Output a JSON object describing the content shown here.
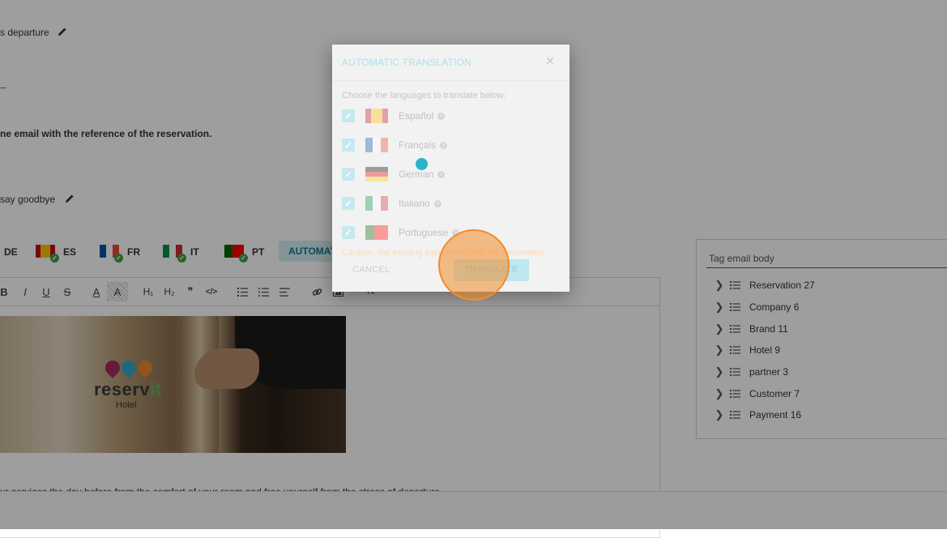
{
  "page": {
    "section_departure": "s departure",
    "email_reference_text": "ne email with the reference of the reservation.",
    "section_goodbye": "say goodbye",
    "body_text": "ur services the day before from the comfort of your room and free yourself from the stress of departure"
  },
  "lang_tabs": [
    {
      "code": "DE"
    },
    {
      "code": "ES",
      "colors": [
        "#c60b1e",
        "#ffc400",
        "#c60b1e"
      ]
    },
    {
      "code": "FR",
      "colors": [
        "#0055a4",
        "#ffffff",
        "#ef4135"
      ]
    },
    {
      "code": "IT",
      "colors": [
        "#009246",
        "#ffffff",
        "#ce2b37"
      ]
    },
    {
      "code": "PT",
      "colors": [
        "#006600",
        "#ff0000",
        "#ff0000"
      ]
    }
  ],
  "auto_translate_button": "AUTOMATI",
  "toolbar": {
    "icons": [
      "bold-icon",
      "italic-icon",
      "underline-icon",
      "strikethrough-icon",
      "font-color-icon",
      "highlight-icon",
      "heading1-icon",
      "heading2-icon",
      "quote-icon",
      "code-icon",
      "ordered-list-icon",
      "bullet-list-icon",
      "align-icon",
      "link-icon",
      "image-icon",
      "clear-format-icon"
    ],
    "glyphs": {
      "bold": "B",
      "italic": "I",
      "underline": "U",
      "strike": "S",
      "fontcolor": "A",
      "highlight": "A",
      "h1": "H₁",
      "h2": "H₂",
      "quote": "❞",
      "code": "</>",
      "link": "🔗",
      "clear": "Tx"
    }
  },
  "image": {
    "logo_text_main": "reserv",
    "logo_text_accent": "it",
    "logo_sub": "Hotel"
  },
  "tag_panel": {
    "input_value": "Tag email body",
    "items": [
      {
        "label": "Reservation 27"
      },
      {
        "label": "Company 6"
      },
      {
        "label": "Brand 11"
      },
      {
        "label": "Hotel 9"
      },
      {
        "label": "partner 3"
      },
      {
        "label": "Customer 7"
      },
      {
        "label": "Payment 16"
      }
    ]
  },
  "dialog": {
    "title": "AUTOMATIC TRANSLATION",
    "close_glyph": "✕",
    "intro": "Choose the languages to translate below:",
    "languages": [
      {
        "name": "Español",
        "checked": true,
        "colors": [
          "#c60b1e",
          "#ffc400",
          "#c60b1e"
        ]
      },
      {
        "name": "Français",
        "checked": true,
        "colors": [
          "#0055a4",
          "#ffffff",
          "#ef4135"
        ]
      },
      {
        "name": "German",
        "checked": true,
        "colors": [
          "#000000",
          "#dd0000",
          "#ffce00"
        ]
      },
      {
        "name": "Italiano",
        "checked": true,
        "colors": [
          "#009246",
          "#ffffff",
          "#ce2b37"
        ]
      },
      {
        "name": "Portuguese",
        "checked": true,
        "colors": [
          "#006600",
          "#ff0000",
          "#ff0000"
        ]
      }
    ],
    "caution": "Caution, the existing translations will be overwritten.",
    "cancel_label": "CANCEL",
    "translate_label": "TRANSLATE"
  },
  "colors": {
    "accent": "#0e7c8a",
    "cursor_dot": "#26b5c9",
    "click_ring": "#f28c28"
  }
}
